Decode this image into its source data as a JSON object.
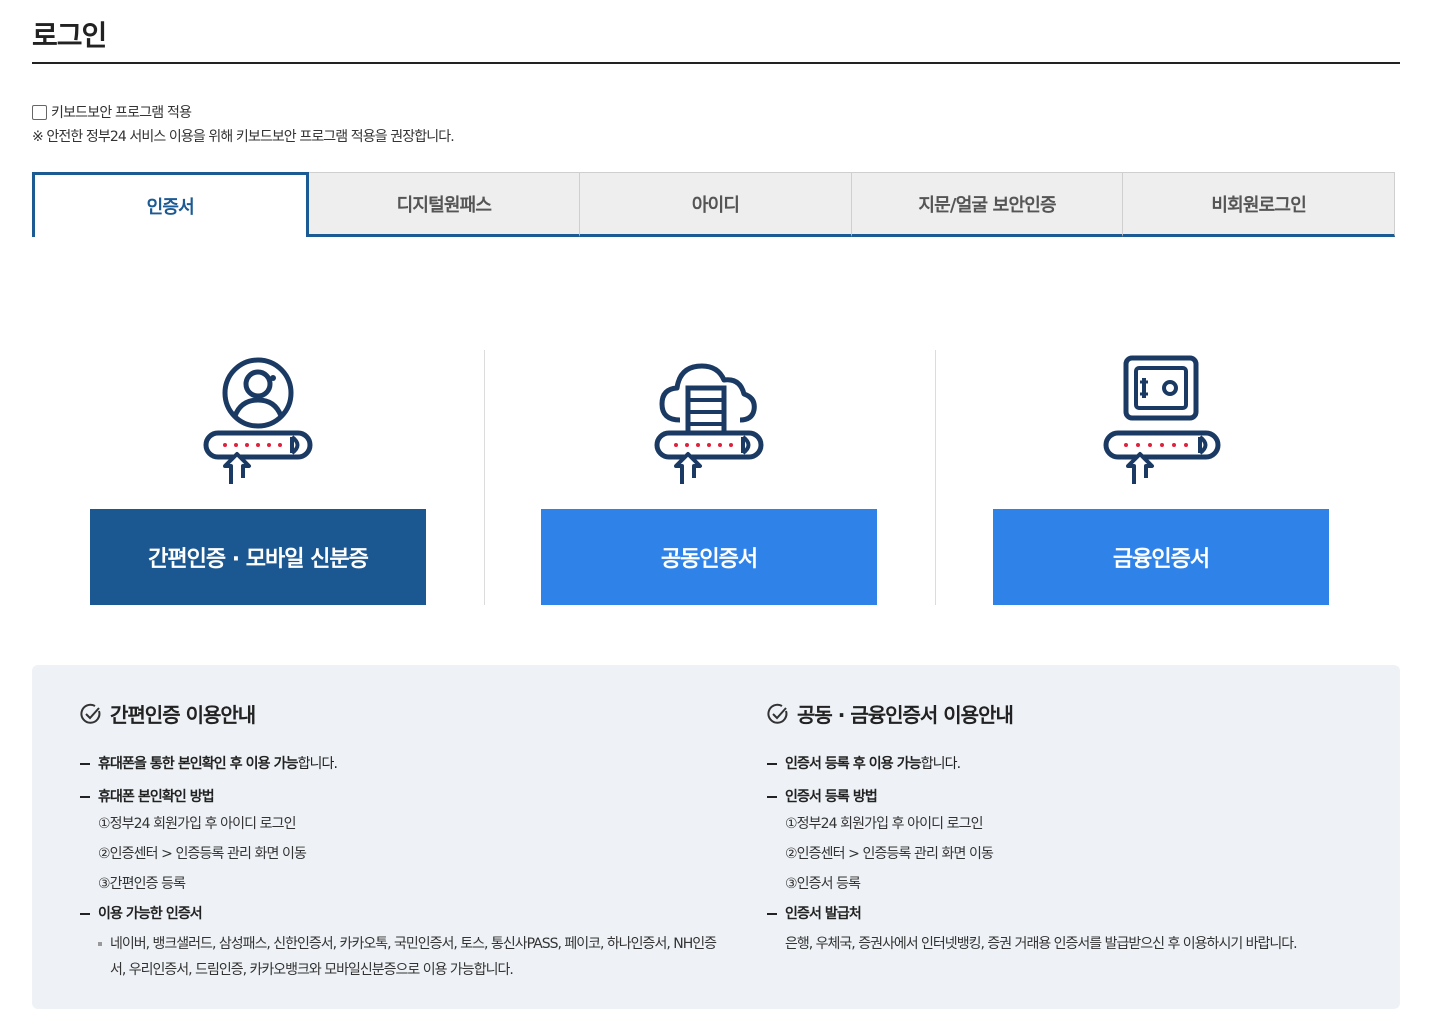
{
  "page": {
    "title": "로그인"
  },
  "keyboard_security": {
    "checkbox_label": "키보드보안 프로그램 적용",
    "note": "※ 안전한 정부24 서비스 이용을 위해 키보드보안 프로그램 적용을 권장합니다."
  },
  "tabs": [
    {
      "label": "인증서",
      "active": true
    },
    {
      "label": "디지털원패스",
      "active": false
    },
    {
      "label": "아이디",
      "active": false
    },
    {
      "label": "지문/얼굴 보안인증",
      "active": false
    },
    {
      "label": "비회원로그인",
      "active": false
    }
  ],
  "login_options": [
    {
      "label": "간편인증 · 모바일 신분증",
      "icon": "user-circle-icon"
    },
    {
      "label": "공동인증서",
      "icon": "cloud-server-icon"
    },
    {
      "label": "금융인증서",
      "icon": "safe-icon"
    }
  ],
  "guide": {
    "simple": {
      "title": "간편인증 이용안내",
      "item1_bold": "휴대폰을 통한 본인확인 후 이용 가능",
      "item1_rest": "합니다.",
      "item2_bold": "휴대폰 본인확인 방법",
      "steps": [
        "①정부24 회원가입 후 아이디 로그인",
        "②인증센터 > 인증등록 관리 화면 이동",
        "③간편인증 등록"
      ],
      "item3_bold": "이용 가능한 인증서",
      "available": "네이버, 뱅크샐러드, 삼성패스, 신한인증서, 카카오톡, 국민인증서, 토스, 통신사PASS, 페이코, 하나인증서, NH인증서, 우리인증서, 드림인증, 카카오뱅크와 모바일신분증으로 이용 가능합니다."
    },
    "cert": {
      "title": "공동 · 금융인증서 이용안내",
      "item1_bold": "인증서 등록 후 이용 가능",
      "item1_rest": "합니다.",
      "item2_bold": "인증서 등록 방법",
      "steps": [
        "①정부24 회원가입 후 아이디 로그인",
        "②인증센터 > 인증등록 관리 화면 이동",
        "③인증서 등록"
      ],
      "item3_bold": "인증서 발급처",
      "issuer": "은행, 우체국, 증권사에서 인터넷뱅킹, 증권 거래용 인증서를 발급받으신 후 이용하시기 바랍니다."
    }
  },
  "colors": {
    "primary_dark": "#1b5791",
    "primary": "#2f83e8",
    "tab_border": "#1c5a93",
    "guide_bg": "#eef2f6"
  }
}
